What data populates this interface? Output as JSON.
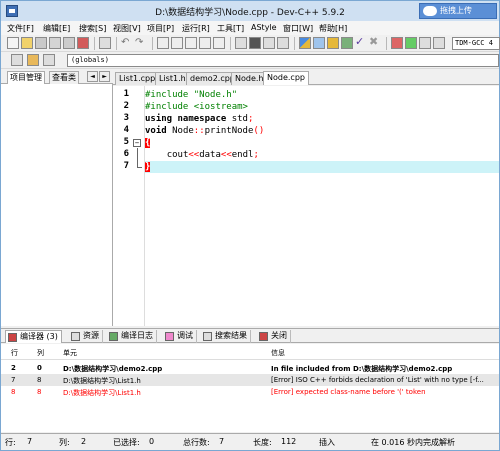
{
  "window": {
    "title": "D:\\数据结构学习\\Node.cpp - Dev-C++ 5.9.2",
    "cloud_button": "拖拽上传"
  },
  "menu": [
    "文件[F]",
    "编辑[E]",
    "搜索[S]",
    "视图[V]",
    "项目[P]",
    "运行[R]",
    "工具[T]",
    "AStyle",
    "窗口[W]",
    "帮助[H]"
  ],
  "toolbar": {
    "compiler": "TDM-GCC 4",
    "globals": "(globals)"
  },
  "left_panel": {
    "tabs": [
      "项目管理",
      "查看类"
    ],
    "arrow_left": "◄",
    "arrow_right": "►"
  },
  "editor_tabs": [
    "List1.cpp",
    "List1.h",
    "demo2.cpp",
    "Node.h",
    "Node.cpp"
  ],
  "code": {
    "line_numbers": [
      "1",
      "2",
      "3",
      "4",
      "5",
      "6",
      "7"
    ],
    "l1_a": "#include \"Node.h\"",
    "l2_a": "#include <iostream>",
    "l3_kw1": "using",
    "l3_kw2": " namespace",
    "l3_rest": " std",
    "l3_semi": ";",
    "l4_kw": "void",
    "l4_rest1": " Node",
    "l4_op1": "::",
    "l4_rest2": "printNode",
    "l4_paren": "()",
    "l5_brace": "{",
    "l6_indent": "    ",
    "l6_a": "cout",
    "l6_op1": "<<",
    "l6_b": "data",
    "l6_op2": "<<",
    "l6_c": "endl",
    "l6_semi": ";",
    "l7_brace": "}"
  },
  "bottom_tabs": [
    "编译器 (3)",
    "资源",
    "编译日志",
    "调试",
    "搜索结果",
    "关闭"
  ],
  "results": {
    "headers": {
      "line": "行",
      "col": "列",
      "unit": "单元",
      "info": "信息"
    },
    "rows": [
      {
        "line": "2",
        "col": "0",
        "unit": "D:\\数据结构学习\\demo2.cpp",
        "info": "In file included from D:\\数据结构学习\\demo2.cpp"
      },
      {
        "line": "7",
        "col": "8",
        "unit": "D:\\数据结构学习\\List1.h",
        "info": "[Error] ISO C++ forbids declaration of 'List' with no type [-f..."
      },
      {
        "line": "8",
        "col": "8",
        "unit": "D:\\数据结构学习\\List1.h",
        "info": "[Error] expected class-name before '(' token"
      }
    ]
  },
  "status": {
    "row_label": "行:",
    "row_val": "7",
    "col_label": "列:",
    "col_val": "2",
    "sel_label": "已选择:",
    "sel_val": "0",
    "total_label": "总行数:",
    "total_val": "7",
    "len_label": "长度:",
    "len_val": "112",
    "mode": "插入",
    "parse_time": "在 0.016 秒内完成解析"
  },
  "colors": {
    "preprocessor": "#008000",
    "operator": "#ff0000",
    "active_line": "#cdf3f8",
    "error_text": "#ff0000"
  }
}
